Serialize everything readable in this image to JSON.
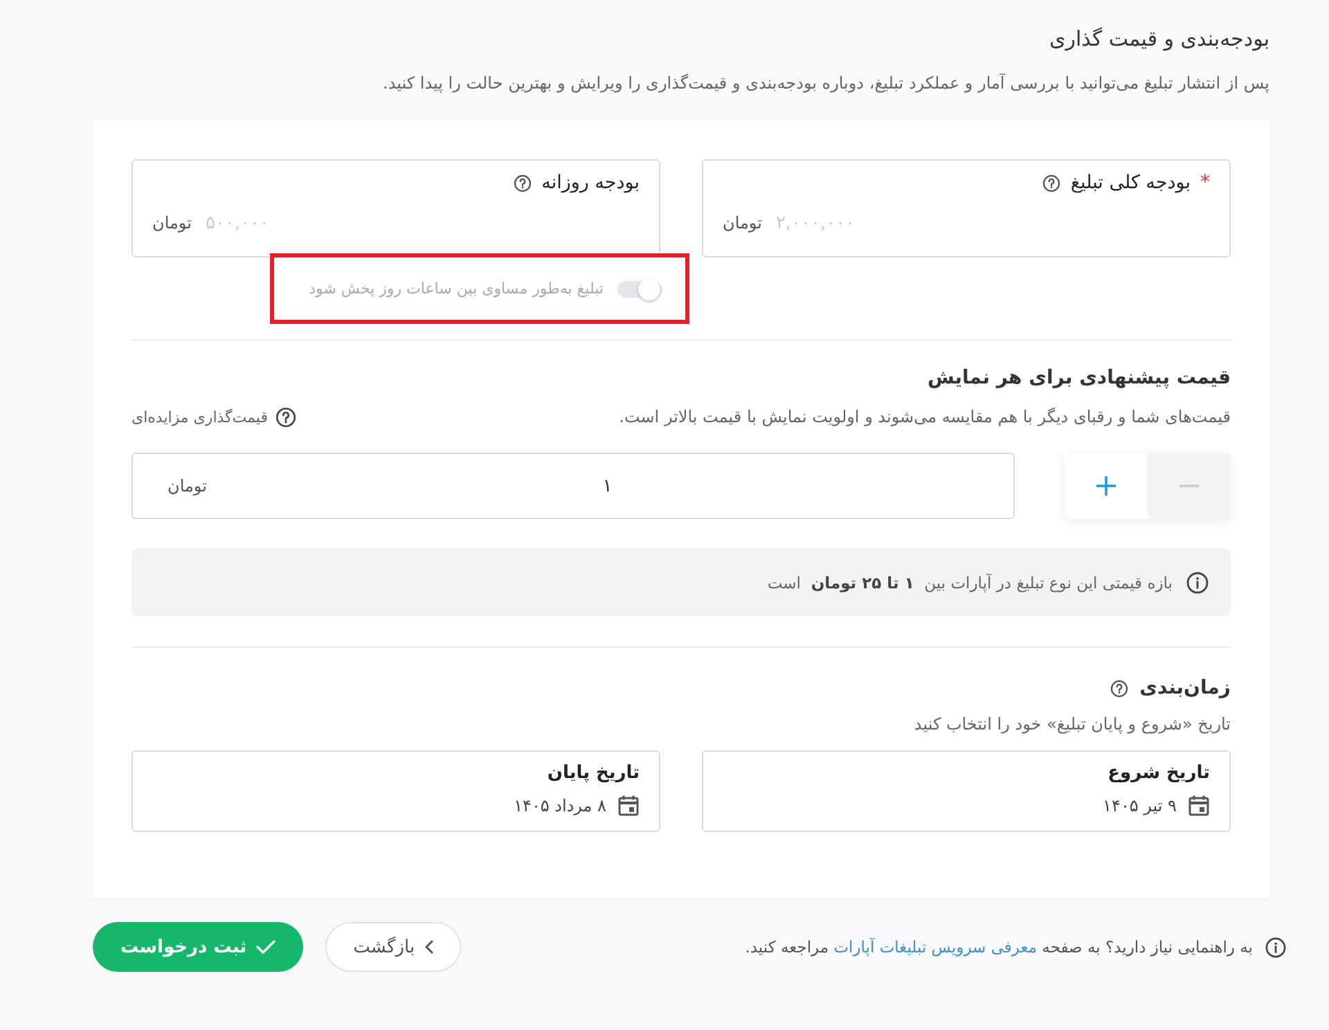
{
  "section": {
    "title": "بودجه‌بندی و قیمت گذاری",
    "description": "پس از انتشار تبلیغ می‌توانید با بررسی آمار و عملکرد تبلیغ، دوباره بودجه‌بندی و قیمت‌گذاری را ویرایش و بهترین حالت را پیدا کنید."
  },
  "budget_fields": [
    {
      "label": "بودجه کلی تبلیغ",
      "required_mark": "*",
      "placeholder": "۲,۰۰۰,۰۰۰",
      "unit": "تومان"
    },
    {
      "label": "بودجه روزانه",
      "placeholder": "۵۰۰,۰۰۰",
      "unit": "تومان",
      "toggle": {
        "label": "تبلیغ به‌طور مساوی بین ساعات روز پخش شود",
        "on": false,
        "disabled": true,
        "highlighted": true
      }
    }
  ],
  "bid": {
    "title": "قیمت پیشنهادی برای هر نمایش",
    "description": "قیمت‌های شما و رقبای دیگر با هم مقایسه می‌شوند و اولویت نمایش با قیمت بالاتر است.",
    "help_link": "قیمت‌گذاری مزایده‌ای",
    "price": {
      "value": "۱",
      "unit": "تومان"
    },
    "stepper": [
      {
        "kind": "decrease",
        "disabled": true
      },
      {
        "kind": "increase",
        "disabled": false
      }
    ],
    "range_note": "بازه قیمتی این نوع تبلیغ در آپارات بین  **۱ تا ۲۵ تومان**  است"
  },
  "schedule": {
    "title": "زمان‌بندی",
    "description": "تاریخ «شروع و پایان تبلیغ» خود را انتخاب کنید",
    "dates": [
      {
        "label": "تاریخ شروع",
        "value": "۹ تیر ۱۴۰۵"
      },
      {
        "label": "تاریخ پایان",
        "value": "۸ مرداد ۱۴۰۵"
      }
    ]
  },
  "footer": {
    "help": {
      "before": "به راهنمایی نیاز دارید؟ به صفحه",
      "link": "معرفی سرویس تبلیغات آپارات",
      "after": "مراجعه کنید."
    },
    "buttons": [
      {
        "kind": "back",
        "label": "بازگشت"
      },
      {
        "kind": "submit",
        "label": "ثبت درخواست"
      }
    ]
  }
}
